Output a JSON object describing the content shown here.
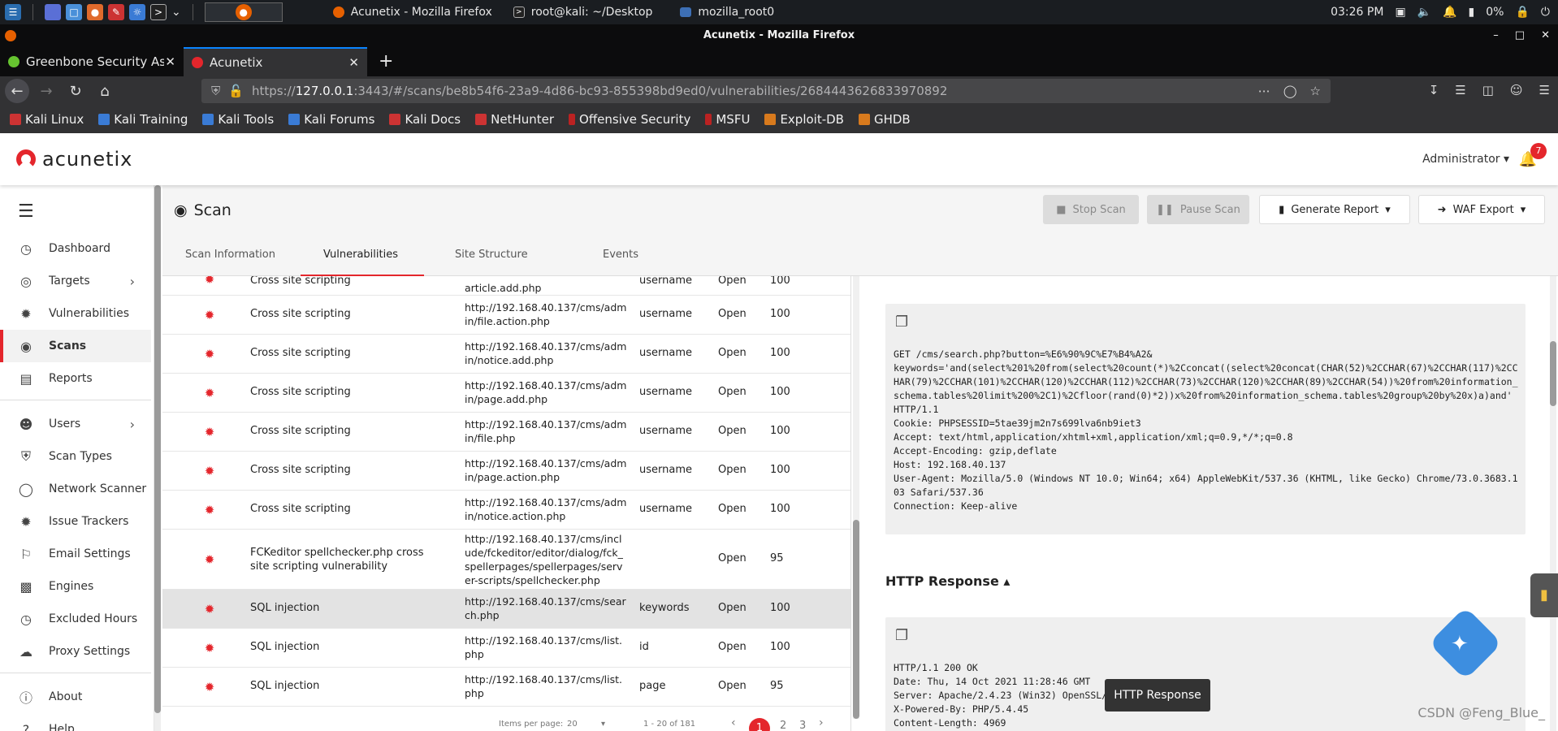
{
  "os": {
    "windows": [
      {
        "label": "Acunetix - Mozilla Firefox"
      },
      {
        "label": "root@kali: ~/Desktop"
      },
      {
        "label": "mozilla_root0"
      }
    ],
    "clock": "03:26 PM",
    "battery": "0%"
  },
  "browser": {
    "window_title": "Acunetix - Mozilla Firefox",
    "tabs": [
      {
        "label": "Greenbone Security Assis"
      },
      {
        "label": "Acunetix"
      }
    ],
    "url_prefix": "https://",
    "url_host": "127.0.0.1",
    "url_rest": ":3443/#/scans/be8b54f6-23a9-4d86-bc93-855398bd9ed0/vulnerabilities/2684443626833970892",
    "bookmarks": [
      "Kali Linux",
      "Kali Training",
      "Kali Tools",
      "Kali Forums",
      "Kali Docs",
      "NetHunter",
      "Offensive Security",
      "MSFU",
      "Exploit-DB",
      "GHDB"
    ]
  },
  "header": {
    "logo_text": "acunetix",
    "user": "Administrator",
    "notification_count": "7"
  },
  "sidebar": {
    "items": [
      {
        "label": "Dashboard"
      },
      {
        "label": "Targets"
      },
      {
        "label": "Vulnerabilities"
      },
      {
        "label": "Scans"
      },
      {
        "label": "Reports"
      },
      {
        "label": "Users"
      },
      {
        "label": "Scan Types"
      },
      {
        "label": "Network Scanner"
      },
      {
        "label": "Issue Trackers"
      },
      {
        "label": "Email Settings"
      },
      {
        "label": "Engines"
      },
      {
        "label": "Excluded Hours"
      },
      {
        "label": "Proxy Settings"
      },
      {
        "label": "About"
      },
      {
        "label": "Help"
      }
    ]
  },
  "scan": {
    "title": "Scan",
    "buttons": {
      "stop": "Stop Scan",
      "pause": "Pause Scan",
      "report": "Generate Report",
      "waf": "WAF Export"
    },
    "tabs": [
      "Scan Information",
      "Vulnerabilities",
      "Site Structure",
      "Events"
    ]
  },
  "vulns": [
    {
      "name": "Cross site scripting",
      "url": "article.add.php",
      "param": "username",
      "status": "Open",
      "confidence": "100"
    },
    {
      "name": "Cross site scripting",
      "url": "http://192.168.40.137/cms/admin/file.action.php",
      "param": "username",
      "status": "Open",
      "confidence": "100"
    },
    {
      "name": "Cross site scripting",
      "url": "http://192.168.40.137/cms/admin/notice.add.php",
      "param": "username",
      "status": "Open",
      "confidence": "100"
    },
    {
      "name": "Cross site scripting",
      "url": "http://192.168.40.137/cms/admin/page.add.php",
      "param": "username",
      "status": "Open",
      "confidence": "100"
    },
    {
      "name": "Cross site scripting",
      "url": "http://192.168.40.137/cms/admin/file.php",
      "param": "username",
      "status": "Open",
      "confidence": "100"
    },
    {
      "name": "Cross site scripting",
      "url": "http://192.168.40.137/cms/admin/page.action.php",
      "param": "username",
      "status": "Open",
      "confidence": "100"
    },
    {
      "name": "Cross site scripting",
      "url": "http://192.168.40.137/cms/admin/notice.action.php",
      "param": "username",
      "status": "Open",
      "confidence": "100"
    },
    {
      "name": "FCKeditor spellchecker.php cross site scripting vulnerability",
      "url": "http://192.168.40.137/cms/include/fckeditor/editor/dialog/fck_spellerpages/spellerpages/server-scripts/spellchecker.php",
      "param": "",
      "status": "Open",
      "confidence": "95"
    },
    {
      "name": "SQL injection",
      "url": "http://192.168.40.137/cms/search.php",
      "param": "keywords",
      "status": "Open",
      "confidence": "100"
    },
    {
      "name": "SQL injection",
      "url": "http://192.168.40.137/cms/list.php",
      "param": "id",
      "status": "Open",
      "confidence": "100"
    },
    {
      "name": "SQL injection",
      "url": "http://192.168.40.137/cms/list.php",
      "param": "page",
      "status": "Open",
      "confidence": "95"
    }
  ],
  "pager": {
    "items_per_page_label": "Items per page:",
    "items_per_page": "20",
    "range": "1 - 20 of 181",
    "pages": [
      "1",
      "2",
      "3"
    ]
  },
  "detail": {
    "request": "GET /cms/search.php?button=%E6%90%9C%E7%B4%A2&\nkeywords='and(select%201%20from(select%20count(*)%2Cconcat((select%20concat(CHAR(52)%2CCHAR(67)%2CCHAR(117)%2CCHAR(79)%2CCHAR(101)%2CCHAR(120)%2CCHAR(112)%2CCHAR(73)%2CCHAR(120)%2CCHAR(89)%2CCHAR(54))%20from%20information_schema.tables%20limit%200%2C1)%2Cfloor(rand(0)*2))x%20from%20information_schema.tables%20group%20by%20x)a)and' HTTP/1.1\nCookie: PHPSESSID=5tae39jm2n7s699lva6nb9iet3\nAccept: text/html,application/xhtml+xml,application/xml;q=0.9,*/*;q=0.8\nAccept-Encoding: gzip,deflate\nHost: 192.168.40.137\nUser-Agent: Mozilla/5.0 (Windows NT 10.0; Win64; x64) AppleWebKit/537.36 (KHTML, like Gecko) Chrome/73.0.3683.103 Safari/537.36\nConnection: Keep-alive",
    "response_heading": "HTTP Response",
    "response": "HTTP/1.1 200 OK\nDate: Thu, 14 Oct 2021 11:28:46 GMT\nServer: Apache/2.4.23 (Win32) OpenSSL/1.0.2j PHP/5.4.45\nX-Powered-By: PHP/5.4.45\nContent-Length: 4969",
    "tooltip": "HTTP Response"
  },
  "watermark": "CSDN @Feng_Blue_",
  "colors": {
    "accent": "#e4262c",
    "browser_dark": "#323234"
  }
}
